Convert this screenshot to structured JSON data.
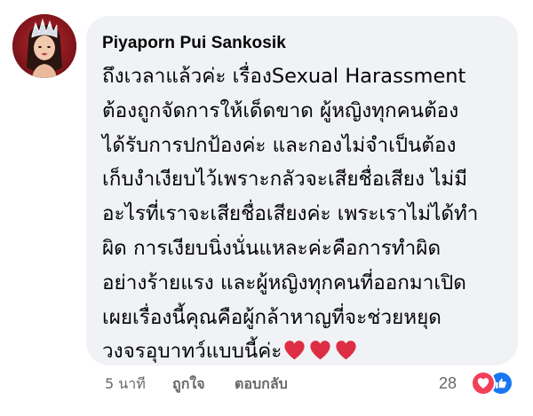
{
  "comment": {
    "author": "Piyaporn Pui Sankosik",
    "text_lines": [
      "ถึงเวลาแล้วค่ะ เรื่องSexual Harassment",
      "ต้องถูกจัดการให้เด็ดขาด ผู้หญิงทุกคนต้อง",
      "ได้รับการปกป้องค่ะ และกองไม่จำเป็นต้อง",
      "เก็บงำเงียบไว้เพราะกลัวจะเสียชื่อเสียง ไม่มี",
      "อะไรที่เราจะเสียชื่อเสียงค่ะ เพระเราไม่ได้ทำ",
      "ผิด การเงียบนิ่งนั่นแหละค่ะคือการทำผิด",
      "อย่างร้ายแรง และผู้หญิงทุกคนที่ออกมาเปิด",
      "เผยเรื่องนี้คุณคือผู้กล้าหาญที่จะช่วยหยุด",
      "วงจรอุบาทว์แบบนี้ค่ะ"
    ],
    "trailing_emoji": [
      "heart-icon",
      "heart-icon",
      "heart-icon"
    ]
  },
  "actions": {
    "timestamp": "5 นาที",
    "like_label": "ถูกใจ",
    "reply_label": "ตอบกลับ"
  },
  "reactions": {
    "count": "28",
    "types": [
      "love-reaction-icon",
      "like-reaction-icon"
    ]
  },
  "colors": {
    "bubble_bg": "#f0f2f5",
    "text": "#050505",
    "secondary_text": "#65676b",
    "heart_red": "#dd2e44",
    "love_reaction": "#f33e58",
    "like_reaction": "#1877f2"
  }
}
